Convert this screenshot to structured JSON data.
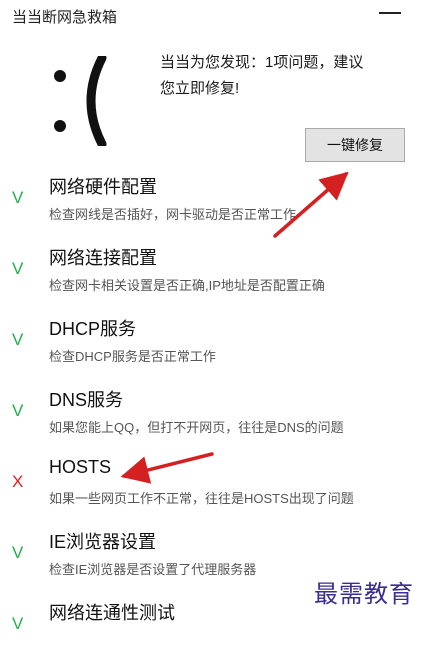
{
  "window": {
    "title": "当当断网急救箱"
  },
  "face": "face-icon",
  "message": {
    "line1": "当当为您发现：1项问题，建议",
    "line2": "您立即修复!"
  },
  "fix_button": {
    "label": "一键修复"
  },
  "status_icons": {
    "ok": "V",
    "fail": "X"
  },
  "colors": {
    "ok": "#22b04b",
    "fail": "#e02020",
    "annotation": "#d42020",
    "watermark": "#3b2c93"
  },
  "items": [
    {
      "name": "网络硬件配置",
      "desc": "检查网线是否插好，网卡驱动是否正常工作",
      "status": "ok"
    },
    {
      "name": "网络连接配置",
      "desc": "检查网卡相关设置是否正确,IP地址是否配置正确",
      "status": "ok"
    },
    {
      "name": "DHCP服务",
      "desc": "检查DHCP服务是否正常工作",
      "status": "ok"
    },
    {
      "name": "DNS服务",
      "desc": "如果您能上QQ，但打不开网页，往往是DNS的问题",
      "status": "ok"
    },
    {
      "name": "HOSTS",
      "desc": "如果一些网页工作不正常，往往是HOSTS出现了问题",
      "status": "fail"
    },
    {
      "name": "IE浏览器设置",
      "desc": "检查IE浏览器是否设置了代理服务器",
      "status": "ok"
    },
    {
      "name": "网络连通性测试",
      "desc": "",
      "status": "ok"
    }
  ],
  "watermark": "最需教育"
}
